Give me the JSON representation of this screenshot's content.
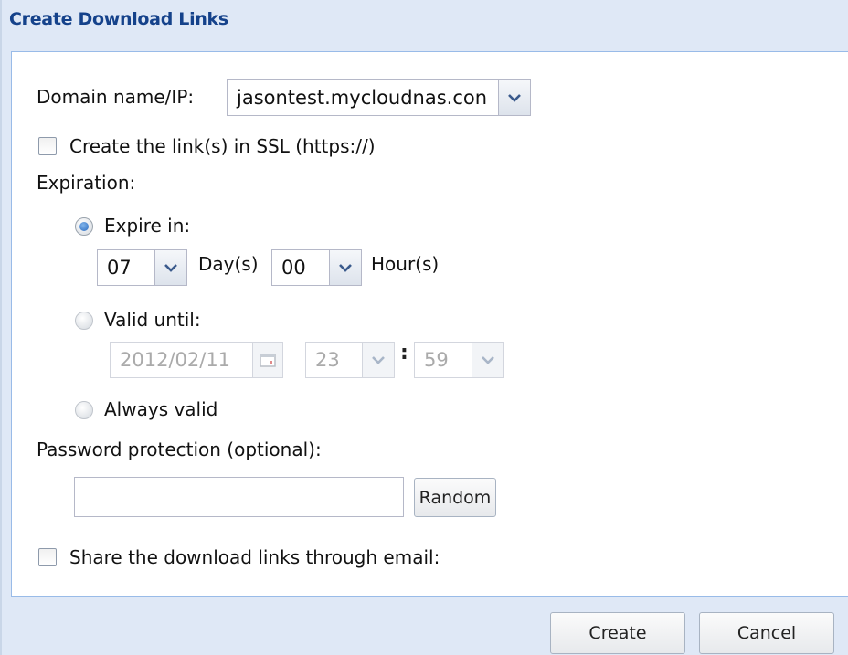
{
  "dialog": {
    "title": "Create Download Links"
  },
  "domain": {
    "label": "Domain name/IP:",
    "value": "jasontest.mycloudnas.con"
  },
  "ssl": {
    "label": "Create the link(s) in SSL (https://)",
    "checked": false
  },
  "expiration": {
    "label": "Expiration:",
    "expire_in": {
      "label": "Expire in:",
      "selected": true,
      "days_value": "07",
      "days_unit": "Day(s)",
      "hours_value": "00",
      "hours_unit": "Hour(s)"
    },
    "valid_until": {
      "label": "Valid until:",
      "selected": false,
      "date": "2012/02/11",
      "hour": "23",
      "separator": ":",
      "minute": "59"
    },
    "always_valid": {
      "label": "Always valid",
      "selected": false
    }
  },
  "password": {
    "label": "Password protection (optional):",
    "value": "",
    "random_label": "Random"
  },
  "email": {
    "label": "Share the download links through email:",
    "checked": false
  },
  "footer": {
    "create_label": "Create",
    "cancel_label": "Cancel"
  }
}
